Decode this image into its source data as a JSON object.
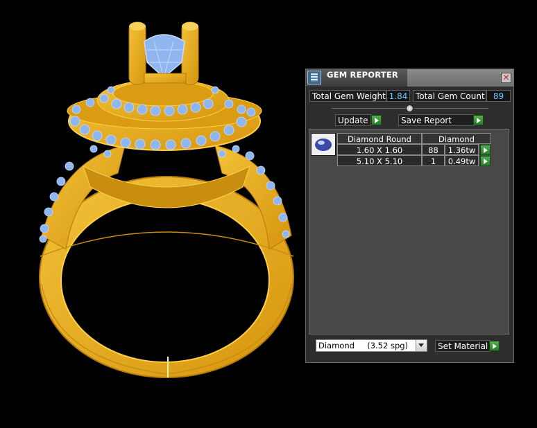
{
  "panel": {
    "title": "GEM REPORTER",
    "close_glyph": "✕",
    "total_weight_label": "Total Gem Weight",
    "total_weight_value": "1.84",
    "total_count_label": "Total Gem Count",
    "total_count_value": "89",
    "update_label": "Update",
    "save_report_label": "Save Report",
    "table": {
      "headers": [
        "Diamond Round",
        "Diamond"
      ],
      "rows": [
        {
          "size": "1.60 X 1.60",
          "count": "88",
          "weight": "1.36tw"
        },
        {
          "size": "5.10 X 5.10",
          "count": "1",
          "weight": "0.49tw"
        }
      ]
    },
    "material_select": "Diamond     (3.52 spg)",
    "set_material_label": "Set Material"
  },
  "colors": {
    "metal": "#e5a81c",
    "metal_dark": "#b57a0a",
    "gem": "#8fb6ee",
    "value_text": "#6fc6ff",
    "go_button": "#3a9a36"
  },
  "icons": {
    "title": "gem-reporter-icon",
    "close": "close-icon",
    "go": "play-arrow-icon",
    "gem": "gem-icon",
    "dropdown": "chevron-down-icon"
  }
}
